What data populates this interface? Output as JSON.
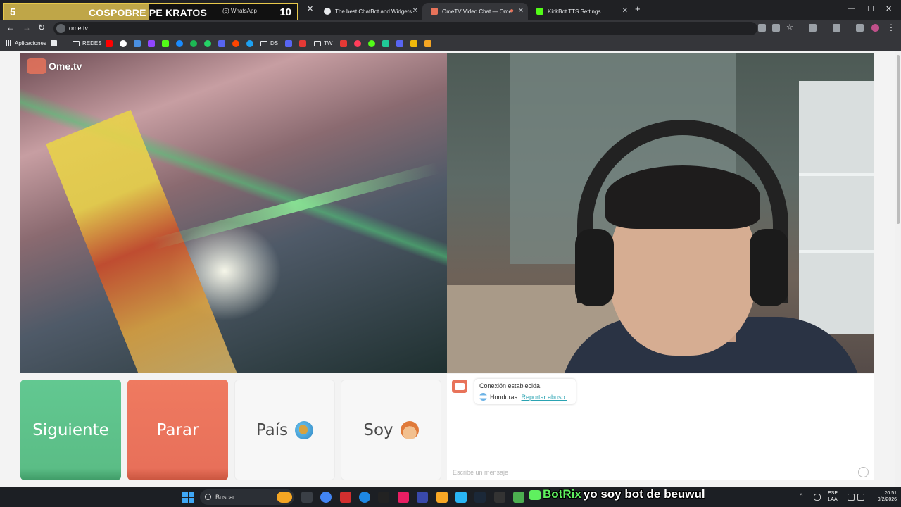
{
  "browser": {
    "tabs": [
      {
        "label": "(5) WhatsApp",
        "active": false
      },
      {
        "label": "The best ChatBot and Widgets",
        "active": false
      },
      {
        "label": "OmeTV Video Chat — Omegle",
        "active": true
      },
      {
        "label": "KickBot TTS Settings",
        "active": false
      }
    ],
    "address": "ome.tv",
    "bookmarks": {
      "apps_label": "Aplicaciones",
      "folders": [
        "REDES",
        "DS",
        "TW"
      ]
    }
  },
  "stream_overlay": {
    "left_score": "5",
    "title": "COSPOBRE PE KRATOS",
    "right_score": "10",
    "bot_name": "BotRix",
    "bot_message": "yo soy bot de beuwul"
  },
  "page": {
    "logo_text": "Ome.tv",
    "controls": {
      "next_label": "Siguiente",
      "stop_label": "Parar",
      "country_label": "País",
      "gender_label": "Soy"
    },
    "chat": {
      "status": "Conexión establecida.",
      "country": "Honduras.",
      "report_link": "Reportar abuso.",
      "placeholder": "Escribe un mensaje"
    }
  },
  "taskbar": {
    "search_label": "Buscar",
    "lang_top": "ESP",
    "lang_bottom": "LAA",
    "time": "20:51",
    "date": "9/2/2026"
  },
  "colors": {
    "next": "#5bbd86",
    "stop": "#e8705a",
    "link": "#2aa3b2"
  }
}
